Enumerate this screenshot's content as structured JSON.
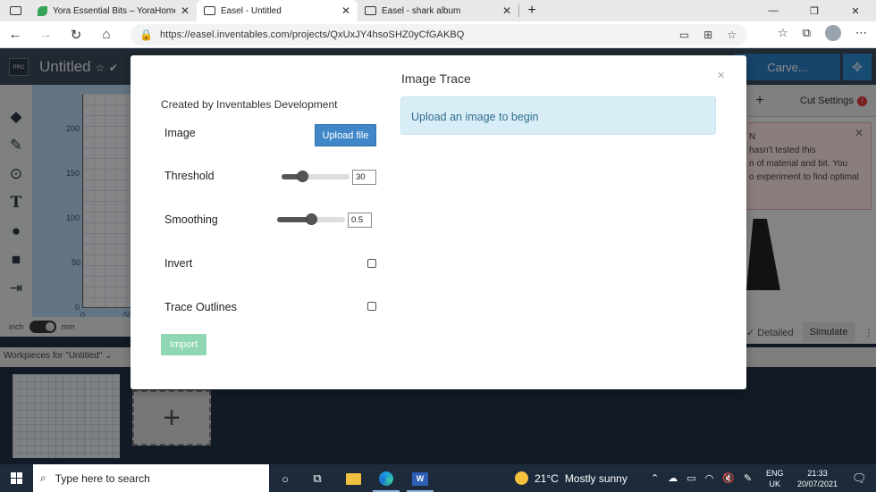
{
  "browser": {
    "tabs": [
      {
        "title": "Yora Essential Bits – YoraHome"
      },
      {
        "title": "Easel - Untitled"
      },
      {
        "title": "Easel - shark album"
      }
    ],
    "url": "https://easel.inventables.com/projects/QxUxJY4hsoSHZ0yCfGAKBQ"
  },
  "app": {
    "logo": "PRO",
    "project_title": "Untitled",
    "carve_label": "Carve...",
    "cut_settings_label": "Cut Settings",
    "warning_text": [
      "N",
      "hasn't tested this",
      "n of material and bit. You",
      "o experiment to find optimal"
    ],
    "unit_inch": "inch",
    "unit_mm": "mm",
    "axis_ticks": [
      "200",
      "150",
      "100",
      "50",
      "0",
      "0",
      "50"
    ],
    "detailed_label": "Detailed",
    "simulate_label": "Simulate",
    "workpieces_label": "Workpieces for \"Untitled\""
  },
  "modal": {
    "title": "Image Trace",
    "credit": "Created by Inventables Development",
    "image_label": "Image",
    "upload_label": "Upload file",
    "threshold_label": "Threshold",
    "threshold_value": "30",
    "threshold_fraction": 0.3,
    "smoothing_label": "Smoothing",
    "smoothing_value": "0.5",
    "smoothing_fraction": 0.5,
    "invert_label": "Invert",
    "trace_outlines_label": "Trace Outlines",
    "import_label": "Import",
    "info_message": "Upload an image to begin",
    "close_glyph": "×"
  },
  "taskbar": {
    "search_placeholder": "Type here to search",
    "temperature": "21°C",
    "weather": "Mostly sunny",
    "lang_top": "ENG",
    "lang_bottom": "UK",
    "time": "21:33",
    "date": "20/07/2021"
  }
}
